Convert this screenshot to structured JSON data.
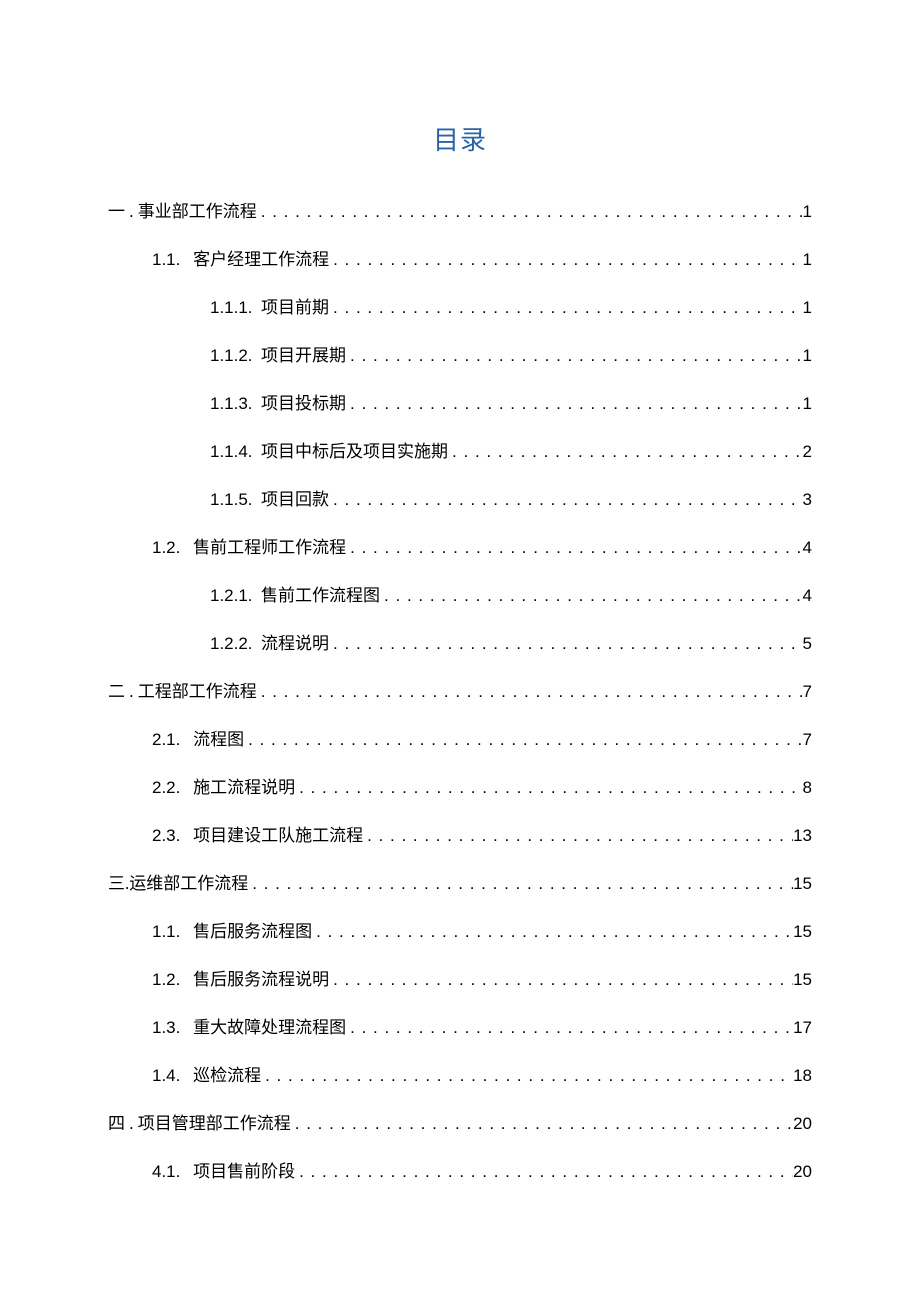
{
  "title": "目录",
  "entries": [
    {
      "level": 1,
      "num": "一 ",
      "sep": ". ",
      "label": "事业部工作流程 ",
      "page": "1",
      "cnNum": true
    },
    {
      "level": 2,
      "num": "1.1.",
      "sep": "   ",
      "label": "客户经理工作流程 ",
      "page": "1"
    },
    {
      "level": 3,
      "num": "1.1.1.",
      "sep": "  ",
      "label": "项目前期",
      "page": "1"
    },
    {
      "level": 3,
      "num": "1.1.2.",
      "sep": "  ",
      "label": "项目开展期",
      "page": "1"
    },
    {
      "level": 3,
      "num": "1.1.3.",
      "sep": "  ",
      "label": "项目投标期",
      "page": "1"
    },
    {
      "level": 3,
      "num": "1.1.4.",
      "sep": "  ",
      "label": "项目中标后及项目实施期",
      "page": "2"
    },
    {
      "level": 3,
      "num": "1.1.5.",
      "sep": "  ",
      "label": "项目回款",
      "page": "3"
    },
    {
      "level": 2,
      "num": "1.2.",
      "sep": "   ",
      "label": "售前工程师工作流程 ",
      "page": "4"
    },
    {
      "level": 3,
      "num": "1.2.1.",
      "sep": "  ",
      "label": "售前工作流程图",
      "page": "4"
    },
    {
      "level": 3,
      "num": "1.2.2.",
      "sep": "  ",
      "label": "流程说明",
      "page": "5"
    },
    {
      "level": 1,
      "num": "二 ",
      "sep": ". ",
      "label": "工程部工作流程 ",
      "page": "7",
      "cnNum": true
    },
    {
      "level": 2,
      "num": "2.1.",
      "sep": "   ",
      "label": "流程图 ",
      "page": "7"
    },
    {
      "level": 2,
      "num": "2.2.",
      "sep": "   ",
      "label": "施工流程说明 ",
      "page": " 8"
    },
    {
      "level": 2,
      "num": "2.3.",
      "sep": "   ",
      "label": "项目建设工队施工流程 ",
      "page": " 13"
    },
    {
      "level": 1,
      "num": "三.",
      "sep": "",
      "label": "运维部工作流程 ",
      "page": " 15",
      "cnNum": true
    },
    {
      "level": 2,
      "num": "1.1.",
      "sep": "   ",
      "label": "售后服务流程图 ",
      "page": " 15"
    },
    {
      "level": 2,
      "num": "1.2.",
      "sep": "   ",
      "label": "售后服务流程说明 ",
      "page": " 15"
    },
    {
      "level": 2,
      "num": "1.3.",
      "sep": "   ",
      "label": "重大故障处理流程图 ",
      "page": " 17"
    },
    {
      "level": 2,
      "num": "1.4.",
      "sep": "   ",
      "label": "巡检流程 ",
      "page": " 18"
    },
    {
      "level": 1,
      "num": "四 ",
      "sep": ". ",
      "label": "项目管理部工作流程 ",
      "page": " 20",
      "cnNum": true
    },
    {
      "level": 2,
      "num": "4.1.",
      "sep": "   ",
      "label": "项目售前阶段 ",
      "page": " 20"
    }
  ]
}
